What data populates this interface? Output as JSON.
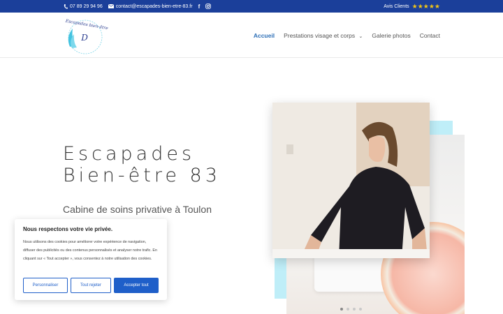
{
  "topbar": {
    "phone": "07 89 29 94 96",
    "email": "contact@escapades-bien-etre-83.fr",
    "facebook_glyph": "f",
    "reviews_label": "Avis Clients",
    "stars": "★★★★★",
    "colors": {
      "bar": "#1b3f9a",
      "stars": "#f3c614"
    }
  },
  "logo": {
    "script_text": "Escapades bien-être",
    "monogram": "D"
  },
  "nav": {
    "items": [
      {
        "label": "Accueil"
      },
      {
        "label": "Prestations visage et corps"
      },
      {
        "label": "Galerie photos"
      },
      {
        "label": "Contact"
      }
    ],
    "active_color": "#2d6fb7"
  },
  "hero": {
    "title_line1": "Escapades",
    "title_line2": "Bien-être 83",
    "subtitle": "Cabine de soins privative à Toulon"
  },
  "slider": {
    "slides": 4,
    "active": 1
  },
  "cookie": {
    "title": "Nous respectons votre vie privée.",
    "text": "Nous utilisons des cookies pour améliorer votre expérience de navigation, diffuser des publicités ou des contenus personnalisés et analyser notre trafic. En cliquant sur « Tout accepter », vous consentez à notre utilisation des cookies.",
    "customize": "Personnaliser",
    "reject": "Tout rejeter",
    "accept": "Accepter tout",
    "accent": "#1f5fc9"
  }
}
